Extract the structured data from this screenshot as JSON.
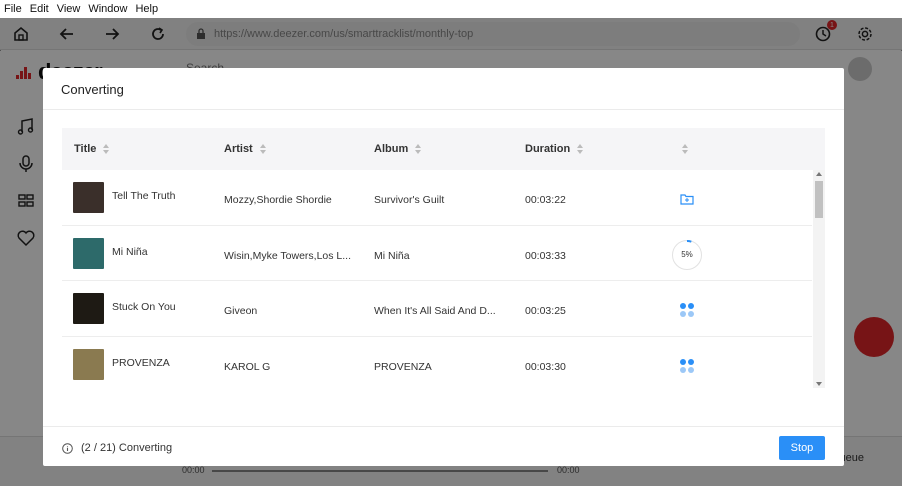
{
  "menubar": {
    "items": [
      "File",
      "Edit",
      "View",
      "Window",
      "Help"
    ]
  },
  "toolbar": {
    "url": "https://www.deezer.com/us/smarttracklist/monthly-top",
    "history_badge": "1"
  },
  "app": {
    "logo_text": "deezer",
    "search_placeholder": "Search",
    "player_queue_label": "Queue",
    "time_left": "00:00",
    "time_right": "00:00"
  },
  "dialog": {
    "title": "Converting",
    "columns": [
      "Title",
      "Artist",
      "Album",
      "Duration",
      ""
    ],
    "rows": [
      {
        "title": "Tell The Truth",
        "artist": "Mozzy,Shordie Shordie",
        "album": "Survivor's Guilt",
        "duration": "00:03:22",
        "status": "done",
        "cover_color": "#3a2f2a"
      },
      {
        "title": "Mi Niña",
        "artist": "Wisin,Myke Towers,Los L...",
        "album": "Mi Niña",
        "duration": "00:03:33",
        "status": "progress",
        "progress_text": "5%",
        "progress": 0.05,
        "cover_color": "#2d6a6a"
      },
      {
        "title": "Stuck On You",
        "artist": "Giveon",
        "album": "When It's All Said And D...",
        "duration": "00:03:25",
        "status": "waiting",
        "cover_color": "#1e1a14"
      },
      {
        "title": "PROVENZA",
        "artist": "KAROL G",
        "album": "PROVENZA",
        "duration": "00:03:30",
        "status": "waiting",
        "cover_color": "#8a7a50"
      }
    ],
    "footer_status": "(2 / 21) Converting",
    "stop_label": "Stop",
    "accent_color": "#2a8ff7"
  }
}
